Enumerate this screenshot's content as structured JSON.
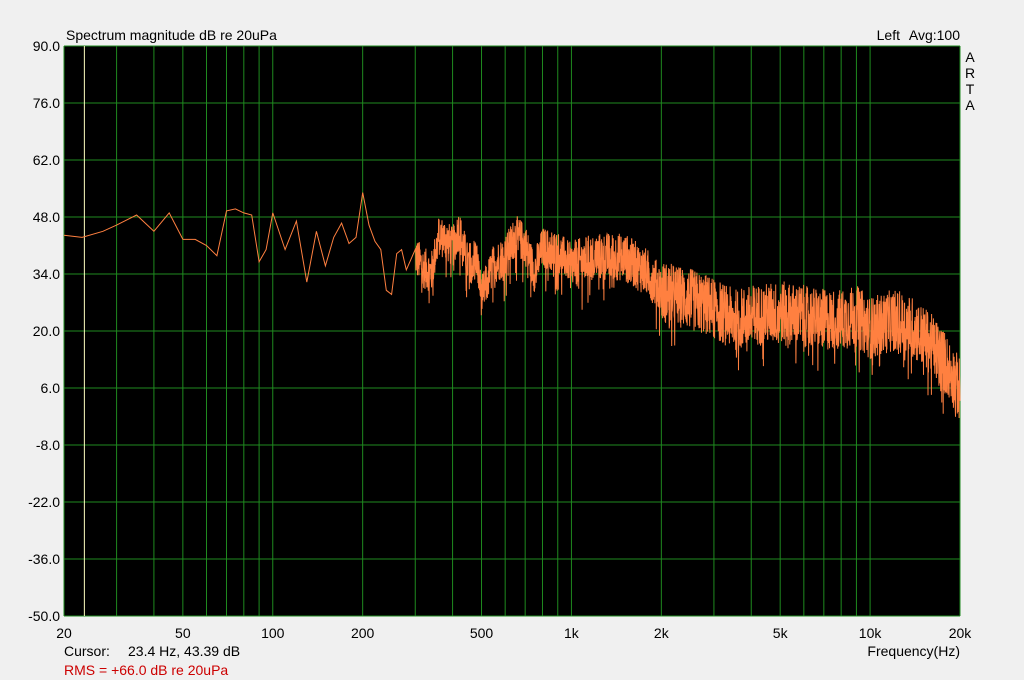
{
  "chart_data": {
    "type": "line",
    "title": "Spectrum magnitude dB re 20uPa",
    "channel_label": "Left",
    "avg_label": "Avg:100",
    "brand_letters": [
      "A",
      "R",
      "T",
      "A"
    ],
    "xlabel": "Frequency(Hz)",
    "x_scale": "log",
    "xlim": [
      20,
      20000
    ],
    "ylim": [
      -50,
      90
    ],
    "grid": true,
    "y_ticks": [
      90,
      76,
      62,
      48,
      34,
      20,
      6,
      -8,
      -22,
      -36,
      -50
    ],
    "y_tick_labels": [
      "90.0",
      "76.0",
      "62.0",
      "48.0",
      "34.0",
      "20.0",
      "6.0",
      "-8.0",
      "-22.0",
      "-36.0",
      "-50.0"
    ],
    "x_tick_values": [
      20,
      50,
      100,
      200,
      500,
      1000,
      2000,
      5000,
      10000,
      20000
    ],
    "x_tick_labels": [
      "20",
      "50",
      "100",
      "200",
      "500",
      "1k",
      "2k",
      "5k",
      "10k",
      "20k"
    ],
    "cursor": {
      "label": "Cursor:",
      "readout": "23.4 Hz, 43.39 dB",
      "x": 23.4,
      "y": 43.39
    },
    "rms_text": "RMS =  +66.0 dB re 20uPa",
    "colors": {
      "background": "#000000",
      "grid": "#1f8a1f",
      "trace": "#ff8040",
      "cursor": "#ffffc0",
      "rms": "#cc0000",
      "frame": "#f0f0f0"
    },
    "series": [
      {
        "x": [
          20,
          23,
          27,
          30,
          35,
          40,
          45,
          50,
          55,
          60,
          65,
          70,
          75,
          80,
          85,
          90,
          95,
          100,
          110,
          120,
          130,
          140,
          150,
          160,
          170,
          180,
          190,
          200,
          210,
          220,
          230,
          240,
          250,
          260,
          270,
          280,
          300,
          320,
          340,
          360,
          380,
          400,
          420,
          450,
          480,
          500,
          550,
          600,
          650,
          700,
          750,
          800,
          900,
          1000,
          1200,
          1500,
          1800,
          2000,
          2500,
          3000,
          3500,
          4000,
          5000,
          6000,
          7000,
          8000,
          9000,
          10000,
          11000,
          12000,
          13000,
          14000,
          15000,
          16000,
          17000,
          18000,
          19000,
          20000
        ],
        "y": [
          43.5,
          43,
          44.5,
          46,
          48.5,
          44.5,
          49,
          42.5,
          42.5,
          41,
          38.5,
          49.5,
          50,
          49,
          48.5,
          37,
          40,
          49,
          40,
          47,
          32,
          44.5,
          36,
          43,
          46.5,
          41.5,
          43,
          54,
          46,
          42,
          40,
          30,
          29,
          39,
          40,
          35,
          40,
          37,
          36,
          45,
          44,
          42,
          46.5,
          38,
          40,
          30,
          38,
          40,
          45,
          43,
          36,
          42,
          41,
          38,
          40,
          40,
          36,
          32,
          30,
          28,
          25,
          26,
          27,
          26,
          25,
          25,
          26,
          23,
          24,
          25,
          24,
          23,
          21,
          19,
          17,
          14,
          11,
          8
        ]
      }
    ]
  }
}
